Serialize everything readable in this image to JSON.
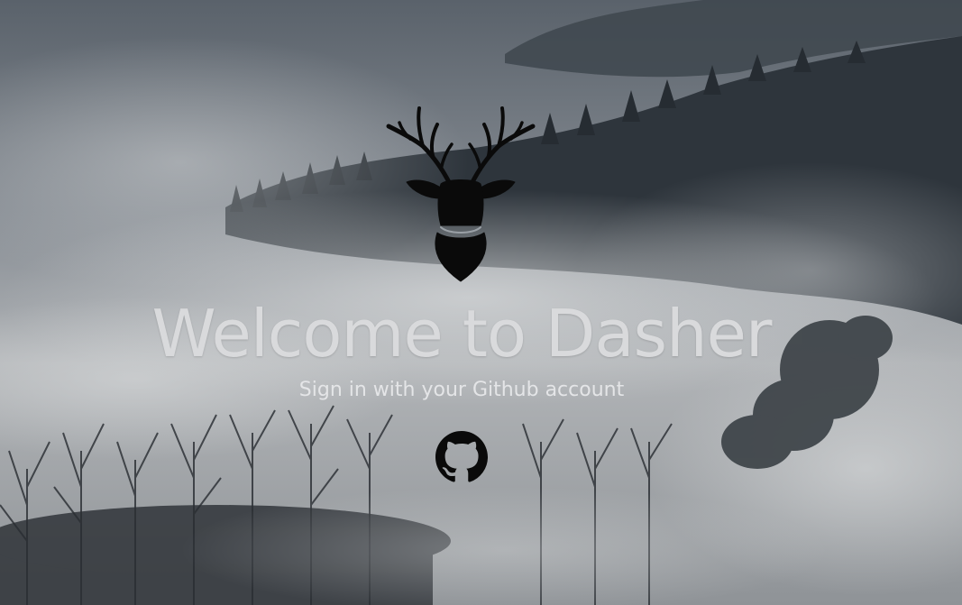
{
  "hero": {
    "title": "Welcome to Dasher",
    "subtitle": "Sign in with your Github account"
  },
  "icons": {
    "logo": "deer-head-icon",
    "signin": "github-icon"
  },
  "colors": {
    "title_text": "#d9dadc",
    "subtitle_text": "#e4e5e7",
    "icon_fill": "#0a0a0a"
  }
}
